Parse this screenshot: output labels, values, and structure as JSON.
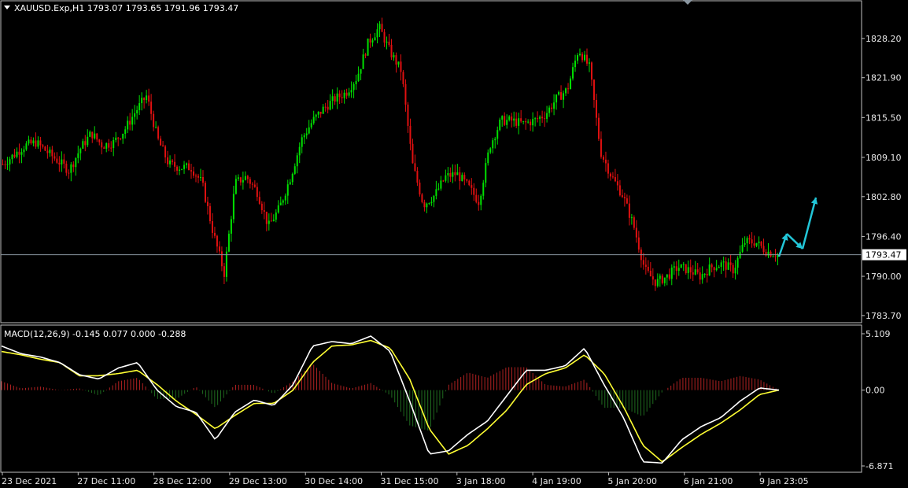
{
  "header": {
    "symbol_text": "XAUUSD.Exp,H1  1793.07 1793.65 1791.96 1793.47"
  },
  "macd_panel": {
    "title_text": "MACD(12,26,9) -0.145 0.077 0.000 -0.288"
  },
  "colors": {
    "background": "#000000",
    "bull": "#00e000",
    "bear": "#e01010",
    "macd_line": "#ffffff",
    "signal_line": "#ffff33",
    "hist_up": "#b22222",
    "hist_down": "#1f6b1f",
    "arrow": "#22c6d8",
    "grid_border": "#c0c0c0"
  },
  "chart_data": [
    {
      "type": "candlestick",
      "price_axis_ticks": [
        "1828.20",
        "1821.90",
        "1815.50",
        "1809.10",
        "1802.80",
        "1796.40",
        "1790.00",
        "1783.70"
      ],
      "current_price_label": "1793.47",
      "current_price": 1793.47,
      "time_axis_labels": [
        "23 Dec 2021",
        "27 Dec 11:00",
        "28 Dec 12:00",
        "29 Dec 13:00",
        "30 Dec 14:00",
        "31 Dec 15:00",
        "3 Jan 18:00",
        "4 Jan 19:00",
        "5 Jan 20:00",
        "6 Jan 21:00",
        "9 Jan 23:05"
      ],
      "ylim": [
        1782.8,
        1834.0
      ],
      "close_series_approx": [
        1808,
        1809.5,
        1811,
        1811.5,
        1810,
        1808.5,
        1807,
        1810.5,
        1813,
        1811,
        1811.5,
        1813.5,
        1816.5,
        1819,
        1812,
        1808,
        1807.5,
        1807.5,
        1805,
        1797,
        1790.5,
        1805,
        1806,
        1803.5,
        1798,
        1801,
        1806,
        1812,
        1815,
        1817,
        1818.5,
        1819.5,
        1822,
        1827.5,
        1830,
        1826,
        1823,
        1808,
        1801.5,
        1803,
        1806,
        1806.5,
        1804.5,
        1802,
        1811,
        1815,
        1815,
        1814.5,
        1815,
        1816,
        1818.5,
        1820,
        1826.5,
        1823.5,
        1810,
        1806,
        1803,
        1798,
        1791,
        1789,
        1790,
        1791.5,
        1791,
        1790,
        1791.5,
        1792,
        1791,
        1795.5,
        1795.5,
        1794,
        1793.47
      ],
      "arrows": "cyan up-down-up projection after last candle"
    },
    {
      "type": "line",
      "name": "MACD(12,26,9)",
      "y_axis_ticks": [
        "5.109",
        "0.00",
        "-6.871"
      ],
      "ylim": [
        -6.871,
        5.109
      ],
      "series": [
        {
          "values": [
            4.0,
            3.3,
            3.0,
            2.5,
            1.4,
            1.0,
            2.0,
            2.5,
            0.0,
            -1.5,
            -2.0,
            -4.5,
            -2.0,
            -0.9,
            -1.4,
            0.5,
            4.0,
            4.4,
            4.2,
            4.9,
            3.5,
            -1.0,
            -5.8,
            -5.5,
            -4.0,
            -2.8,
            -0.5,
            1.8,
            1.8,
            2.2,
            3.8,
            0.5,
            -2.5,
            -6.5,
            -6.6,
            -4.5,
            -3.3,
            -2.5,
            -1.0,
            0.2,
            0.0
          ]
        },
        {
          "values": [
            3.5,
            3.2,
            2.8,
            2.5,
            1.3,
            1.3,
            1.5,
            1.8,
            0.5,
            -1.0,
            -2.2,
            -3.5,
            -2.3,
            -1.2,
            -1.2,
            0.0,
            2.5,
            4.0,
            4.1,
            4.5,
            3.8,
            1.0,
            -3.5,
            -5.8,
            -5.0,
            -3.5,
            -1.8,
            0.5,
            1.5,
            2.0,
            3.2,
            1.5,
            -1.5,
            -5.0,
            -6.5,
            -5.2,
            -4.0,
            -3.0,
            -1.8,
            -0.4,
            0.0
          ]
        }
      ]
    }
  ]
}
